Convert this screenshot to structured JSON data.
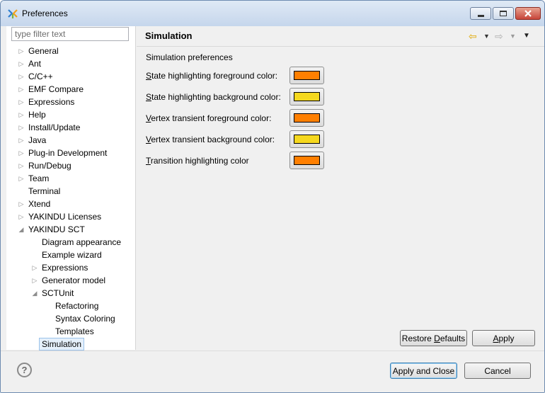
{
  "window": {
    "title": "Preferences"
  },
  "filter": {
    "placeholder": "type filter text"
  },
  "tree": [
    {
      "label": "General",
      "depth": 0,
      "expander": "collapsed"
    },
    {
      "label": "Ant",
      "depth": 0,
      "expander": "collapsed"
    },
    {
      "label": "C/C++",
      "depth": 0,
      "expander": "collapsed"
    },
    {
      "label": "EMF Compare",
      "depth": 0,
      "expander": "collapsed"
    },
    {
      "label": "Expressions",
      "depth": 0,
      "expander": "collapsed"
    },
    {
      "label": "Help",
      "depth": 0,
      "expander": "collapsed"
    },
    {
      "label": "Install/Update",
      "depth": 0,
      "expander": "collapsed"
    },
    {
      "label": "Java",
      "depth": 0,
      "expander": "collapsed"
    },
    {
      "label": "Plug-in Development",
      "depth": 0,
      "expander": "collapsed"
    },
    {
      "label": "Run/Debug",
      "depth": 0,
      "expander": "collapsed"
    },
    {
      "label": "Team",
      "depth": 0,
      "expander": "collapsed"
    },
    {
      "label": "Terminal",
      "depth": 0,
      "expander": "none"
    },
    {
      "label": "Xtend",
      "depth": 0,
      "expander": "collapsed"
    },
    {
      "label": "YAKINDU Licenses",
      "depth": 0,
      "expander": "collapsed"
    },
    {
      "label": "YAKINDU SCT",
      "depth": 0,
      "expander": "expanded"
    },
    {
      "label": "Diagram appearance",
      "depth": 1,
      "expander": "none"
    },
    {
      "label": "Example wizard",
      "depth": 1,
      "expander": "none"
    },
    {
      "label": "Expressions",
      "depth": 1,
      "expander": "collapsed"
    },
    {
      "label": "Generator model",
      "depth": 1,
      "expander": "collapsed"
    },
    {
      "label": "SCTUnit",
      "depth": 1,
      "expander": "expanded"
    },
    {
      "label": "Refactoring",
      "depth": 2,
      "expander": "none"
    },
    {
      "label": "Syntax Coloring",
      "depth": 2,
      "expander": "none"
    },
    {
      "label": "Templates",
      "depth": 2,
      "expander": "none"
    },
    {
      "label": "Simulation",
      "depth": 1,
      "expander": "none",
      "selected": true
    }
  ],
  "page": {
    "title": "Simulation",
    "subtitle": "Simulation preferences",
    "prefs": [
      {
        "mnemonic": "S",
        "rest": "tate highlighting foreground color:",
        "color": "#ff7f00"
      },
      {
        "mnemonic": "S",
        "rest": "tate highlighting background color:",
        "color": "#f5d81e"
      },
      {
        "mnemonic": "V",
        "rest": "ertex transient foreground color:",
        "color": "#ff7f00"
      },
      {
        "mnemonic": "V",
        "rest": "ertex transient background color:",
        "color": "#f5d81e"
      },
      {
        "mnemonic": "T",
        "rest": "ransition highlighting color",
        "color": "#ff7f00"
      }
    ],
    "restore_pre": "Restore ",
    "restore_mn": "D",
    "restore_post": "efaults",
    "apply_mn": "A",
    "apply_post": "pply"
  },
  "footer": {
    "help_glyph": "?",
    "apply_close": "Apply and Close",
    "cancel": "Cancel"
  },
  "icons": {
    "back": "back-arrow-icon",
    "forward": "forward-arrow-icon",
    "menu": "view-menu-icon",
    "app": "eclipse-app-icon"
  }
}
